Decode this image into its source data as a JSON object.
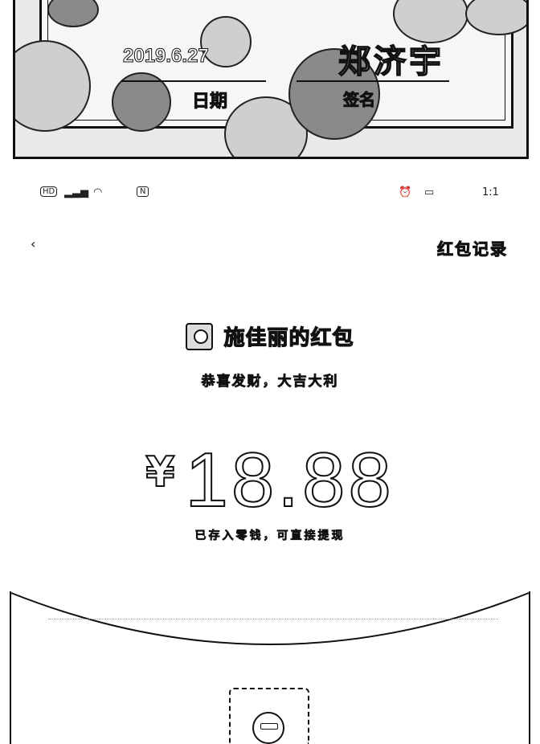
{
  "photo": {
    "date_value": "2019.6.27",
    "date_label": "日期",
    "signature": "郑济宇",
    "signature_label": "签名"
  },
  "status_bar": {
    "hd": "HD",
    "signal_icon": "signal-icon",
    "wifi_icon": "wifi-icon",
    "nfc": "N",
    "alarm_icon": "alarm-icon",
    "battery_icon": "battery-icon",
    "time": "1:1"
  },
  "nav": {
    "back_icon": "back-arrow-icon",
    "record_label": "红包记录"
  },
  "envelope": {
    "sender_name": "施佳丽的红包",
    "greeting": "恭喜发财，大吉大利"
  },
  "amount": {
    "currency": "¥",
    "value": "18.88",
    "deposit_note": "已存入零钱，可直接提现"
  }
}
